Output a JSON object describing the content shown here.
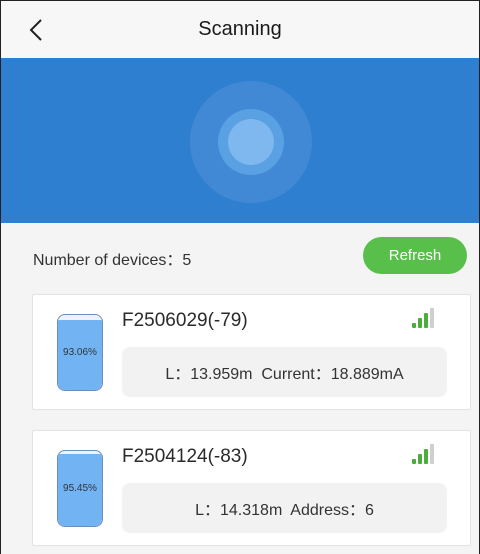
{
  "header": {
    "title": "Scanning",
    "back_icon": "chevron-left-icon"
  },
  "scanner": {
    "icon": "radar-pulse-icon",
    "color": "#2f7fd0"
  },
  "summary": {
    "label": "Number of devices：",
    "count": "5"
  },
  "refresh_button": {
    "label": "Refresh",
    "color": "#58c04a"
  },
  "devices": [
    {
      "name": "F2506029(-79)",
      "battery": {
        "label": "93.06%",
        "level": 0.9306
      },
      "signal_bars_active": 3,
      "signal_bars_total": 4,
      "info": "L：13.959m  Current：18.889mA"
    },
    {
      "name": "F2504124(-83)",
      "battery": {
        "label": "95.45%",
        "level": 0.9545
      },
      "signal_bars_active": 3,
      "signal_bars_total": 4,
      "info": "L：14.318m  Address：6"
    }
  ]
}
